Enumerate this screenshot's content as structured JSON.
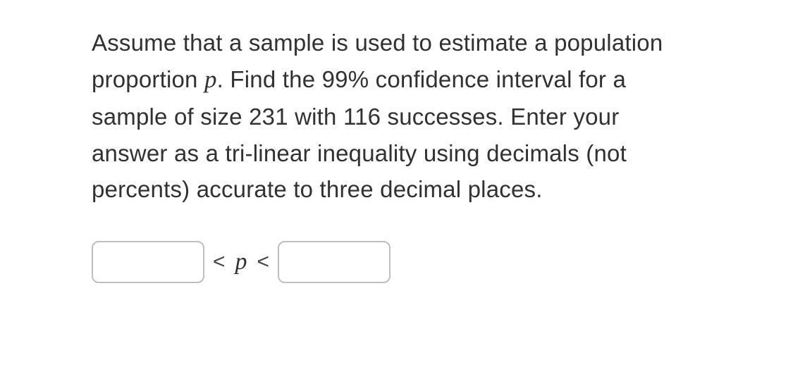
{
  "question": {
    "part1": "Assume that a sample is used to estimate a population proportion ",
    "var": "p",
    "part2": ". Find the 99% confidence interval for a sample of size 231 with 116 successes. Enter your answer as a tri-linear inequality using decimals (not percents) accurate to three decimal places."
  },
  "answer": {
    "lower_value": "",
    "lt1": "<",
    "mid_var": "p",
    "lt2": "<",
    "upper_value": ""
  }
}
